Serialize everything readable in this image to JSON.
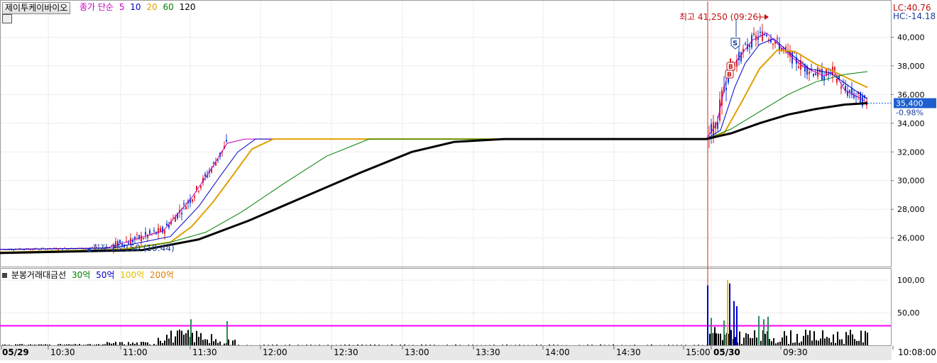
{
  "stock_button": "제이투케이바이오",
  "ma_legend": {
    "label": "종가 단순",
    "periods": [
      {
        "text": "5",
        "color": "#c000c0"
      },
      {
        "text": "10",
        "color": "#0000c8"
      },
      {
        "text": "20",
        "color": "#e0a000"
      },
      {
        "text": "60",
        "color": "#008000"
      },
      {
        "text": "120",
        "color": "#000000"
      }
    ]
  },
  "volume_legend": {
    "label": "분봉거래대금선",
    "items": [
      {
        "text": "30억",
        "color": "#008000"
      },
      {
        "text": "50억",
        "color": "#0000c8"
      },
      {
        "text": "100억",
        "color": "#e0c000"
      },
      {
        "text": "200억",
        "color": "#e08000"
      }
    ]
  },
  "right_top": {
    "lc": "LC:40.76",
    "hc": "HC:-14.18"
  },
  "current_price": {
    "value": "35,400",
    "change": "-0.98%"
  },
  "annotations": {
    "high": "최고 41,250 (09:26)",
    "low": "최저 25,150 (10:44)",
    "sell_marker": "S",
    "buy_marker": "B"
  },
  "colors": {
    "up": "#e02020",
    "down": "#1040d0",
    "ma5": "#c000c0",
    "ma10": "#0000c8",
    "ma20": "#e0a000",
    "ma60": "#008000",
    "ma120": "#000000",
    "threshold_line": "#ff00ff",
    "date_divider": "#e02020",
    "price_tag_bg": "#1e5fd0"
  },
  "chart_data": [
    {
      "type": "line",
      "panel": "price",
      "y_ticks": [
        "40,000",
        "38,000",
        "36,000",
        "34,000",
        "32,000",
        "30,000",
        "28,000",
        "26,000"
      ],
      "ylim": [
        24400,
        42000
      ],
      "x_ticks": [
        "05/29",
        "10:30",
        "11:00",
        "11:30",
        "12:00",
        "12:30",
        "13:00",
        "13:30",
        "14:00",
        "14:30",
        "15:00",
        "05/30",
        "09:30",
        "10:08:00"
      ],
      "series": [
        {
          "key": "ma5",
          "points": [
            [
              0,
              25200
            ],
            [
              150,
              25300
            ],
            [
              230,
              26500
            ],
            [
              270,
              28800
            ],
            [
              300,
              31000
            ],
            [
              320,
              32600
            ],
            [
              345,
              32900
            ],
            [
              995,
              32900
            ],
            [
              1010,
              34000
            ],
            [
              1025,
              37500
            ],
            [
              1040,
              38500
            ],
            [
              1060,
              39800
            ],
            [
              1080,
              40300
            ],
            [
              1100,
              39300
            ],
            [
              1130,
              38000
            ],
            [
              1160,
              37300
            ],
            [
              1175,
              37600
            ],
            [
              1190,
              36300
            ],
            [
              1210,
              35800
            ],
            [
              1222,
              35400
            ]
          ]
        },
        {
          "key": "ma10",
          "points": [
            [
              0,
              25200
            ],
            [
              160,
              25300
            ],
            [
              240,
              26100
            ],
            [
              280,
              28200
            ],
            [
              310,
              30300
            ],
            [
              335,
              32000
            ],
            [
              360,
              32900
            ],
            [
              995,
              32900
            ],
            [
              1015,
              33500
            ],
            [
              1035,
              36500
            ],
            [
              1050,
              38200
            ],
            [
              1070,
              39500
            ],
            [
              1090,
              39900
            ],
            [
              1110,
              39000
            ],
            [
              1140,
              37800
            ],
            [
              1170,
              37500
            ],
            [
              1190,
              36800
            ],
            [
              1210,
              36100
            ],
            [
              1222,
              35700
            ]
          ]
        },
        {
          "key": "ma20",
          "points": [
            [
              0,
              25000
            ],
            [
              170,
              25200
            ],
            [
              240,
              25700
            ],
            [
              270,
              26800
            ],
            [
              300,
              28500
            ],
            [
              330,
              30500
            ],
            [
              355,
              32200
            ],
            [
              385,
              32900
            ],
            [
              995,
              32900
            ],
            [
              1020,
              33300
            ],
            [
              1045,
              35500
            ],
            [
              1070,
              37800
            ],
            [
              1095,
              39100
            ],
            [
              1120,
              39000
            ],
            [
              1150,
              38100
            ],
            [
              1175,
              37600
            ],
            [
              1200,
              37000
            ],
            [
              1222,
              36500
            ]
          ]
        },
        {
          "key": "ma60",
          "points": [
            [
              0,
              25000
            ],
            [
              180,
              25200
            ],
            [
              240,
              25700
            ],
            [
              290,
              26400
            ],
            [
              340,
              27800
            ],
            [
              400,
              29800
            ],
            [
              460,
              31700
            ],
            [
              520,
              32900
            ],
            [
              995,
              32900
            ],
            [
              1030,
              33600
            ],
            [
              1070,
              34800
            ],
            [
              1110,
              36000
            ],
            [
              1150,
              36900
            ],
            [
              1190,
              37400
            ],
            [
              1222,
              37600
            ]
          ]
        },
        {
          "key": "ma120",
          "points": [
            [
              0,
              24950
            ],
            [
              200,
              25150
            ],
            [
              280,
              25900
            ],
            [
              350,
              27200
            ],
            [
              430,
              28900
            ],
            [
              510,
              30600
            ],
            [
              580,
              32000
            ],
            [
              640,
              32700
            ],
            [
              710,
              32900
            ],
            [
              995,
              32900
            ],
            [
              1030,
              33300
            ],
            [
              1070,
              34000
            ],
            [
              1110,
              34600
            ],
            [
              1150,
              35000
            ],
            [
              1190,
              35300
            ],
            [
              1222,
              35400
            ]
          ]
        }
      ],
      "annotations": [
        "최고 41,250 (09:26)",
        "최저 25,150 (10:44)"
      ]
    },
    {
      "type": "bar",
      "panel": "volume",
      "y_ticks": [
        "100,00",
        "50,00"
      ],
      "ylim": [
        0,
        110
      ],
      "threshold": 30,
      "note": "bar values are approximate, estimated from the visible bar heights"
    }
  ]
}
